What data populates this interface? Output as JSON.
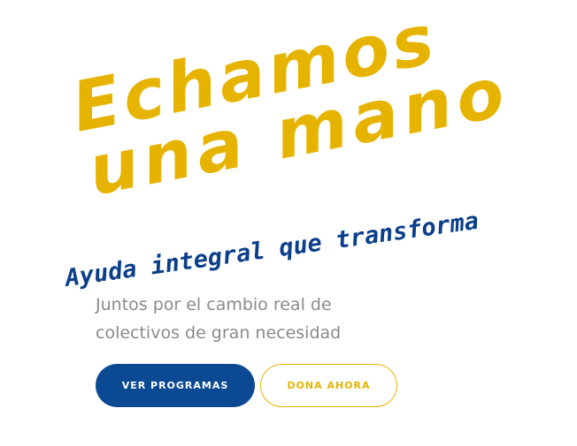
{
  "hero": {
    "headline_line1": "Echamos",
    "headline_line2": "una mano",
    "tagline": "Ayuda integral que transforma",
    "subtitle_line1": "Juntos por el cambio real de",
    "subtitle_line2": "colectivos de gran necesidad",
    "primary_button_label": "VER PROGRAMAS",
    "secondary_button_label": "DONA AHORA"
  },
  "colors": {
    "headline": "#e6b400",
    "tagline": "#0b3f8a",
    "subtitle": "#8a8a8a",
    "primary_button": "#0b4a93",
    "secondary_button_border": "#e6b400",
    "background": "#ffffff"
  }
}
